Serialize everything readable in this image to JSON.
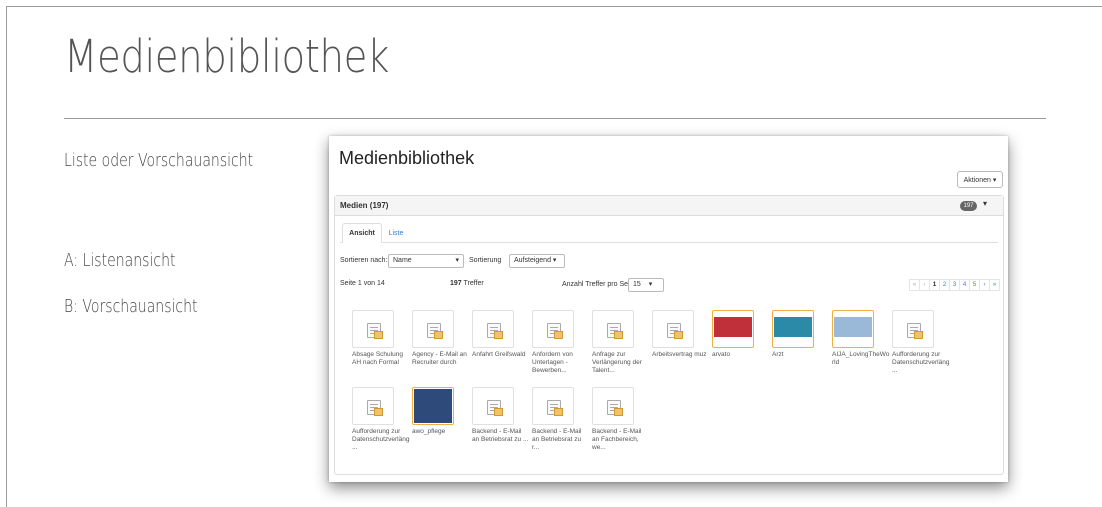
{
  "slide": {
    "title": "Medienbibliothek",
    "bullets": [
      "Liste oder Vorschauansicht",
      "A: Listenansicht",
      "B: Vorschauansicht"
    ]
  },
  "app": {
    "title": "Medienbibliothek",
    "actions_label": "Aktionen ▾",
    "panel_title": "Medien (197)",
    "badge_count": "197",
    "tabs": [
      {
        "label": "Ansicht",
        "active": true
      },
      {
        "label": "Liste",
        "active": false
      }
    ],
    "sort": {
      "sort_by_label": "Sortieren nach:",
      "sort_by_value": "Name",
      "order_label": "Sortierung",
      "order_value": "Aufsteigend ▾"
    },
    "info": {
      "page_info": "Seite 1 von 14",
      "hits_count": "197",
      "hits_suffix": "Treffer",
      "per_page_label": "Anzahl Treffer pro Seite",
      "per_page_value": "15"
    },
    "pagination": [
      "«",
      "‹",
      "1",
      "2",
      "3",
      "4",
      "5",
      "›",
      "»"
    ],
    "current_page": "1",
    "media": [
      {
        "label": "Absage Schulung AH nach Formal",
        "kind": "doc"
      },
      {
        "label": "Agency - E-Mail an Recruiter durch",
        "kind": "doc"
      },
      {
        "label": "Anfahrt Greifswald",
        "kind": "doc"
      },
      {
        "label": "Anfordern von Unterlagen - Bewerben...",
        "kind": "doc"
      },
      {
        "label": "Anfrage zur Verlängerung der Talent...",
        "kind": "doc"
      },
      {
        "label": "Arbeitsvertrag muz",
        "kind": "doc"
      },
      {
        "label": "arvato",
        "kind": "image",
        "color": "#c0303a"
      },
      {
        "label": "Arzt",
        "kind": "image",
        "color": "#2a8aa8"
      },
      {
        "label": "AIJA_LovingTheWorld",
        "kind": "image",
        "color": "#9ab8d8"
      },
      {
        "label": "Aufforderung zur Datenschutzverläng...",
        "kind": "doc"
      },
      {
        "label": "Aufforderung zur Datenschutzverläng...",
        "kind": "doc"
      },
      {
        "label": "awo_pflege",
        "kind": "image",
        "color": "#2d4a7a"
      },
      {
        "label": "Backend - E-Mail an Betriebsrat zu ...",
        "kind": "doc"
      },
      {
        "label": "Backend - E-Mail an Betriebsrat zu r...",
        "kind": "doc"
      },
      {
        "label": "Backend - E-Mail an Fachbereich, we...",
        "kind": "doc"
      }
    ]
  }
}
